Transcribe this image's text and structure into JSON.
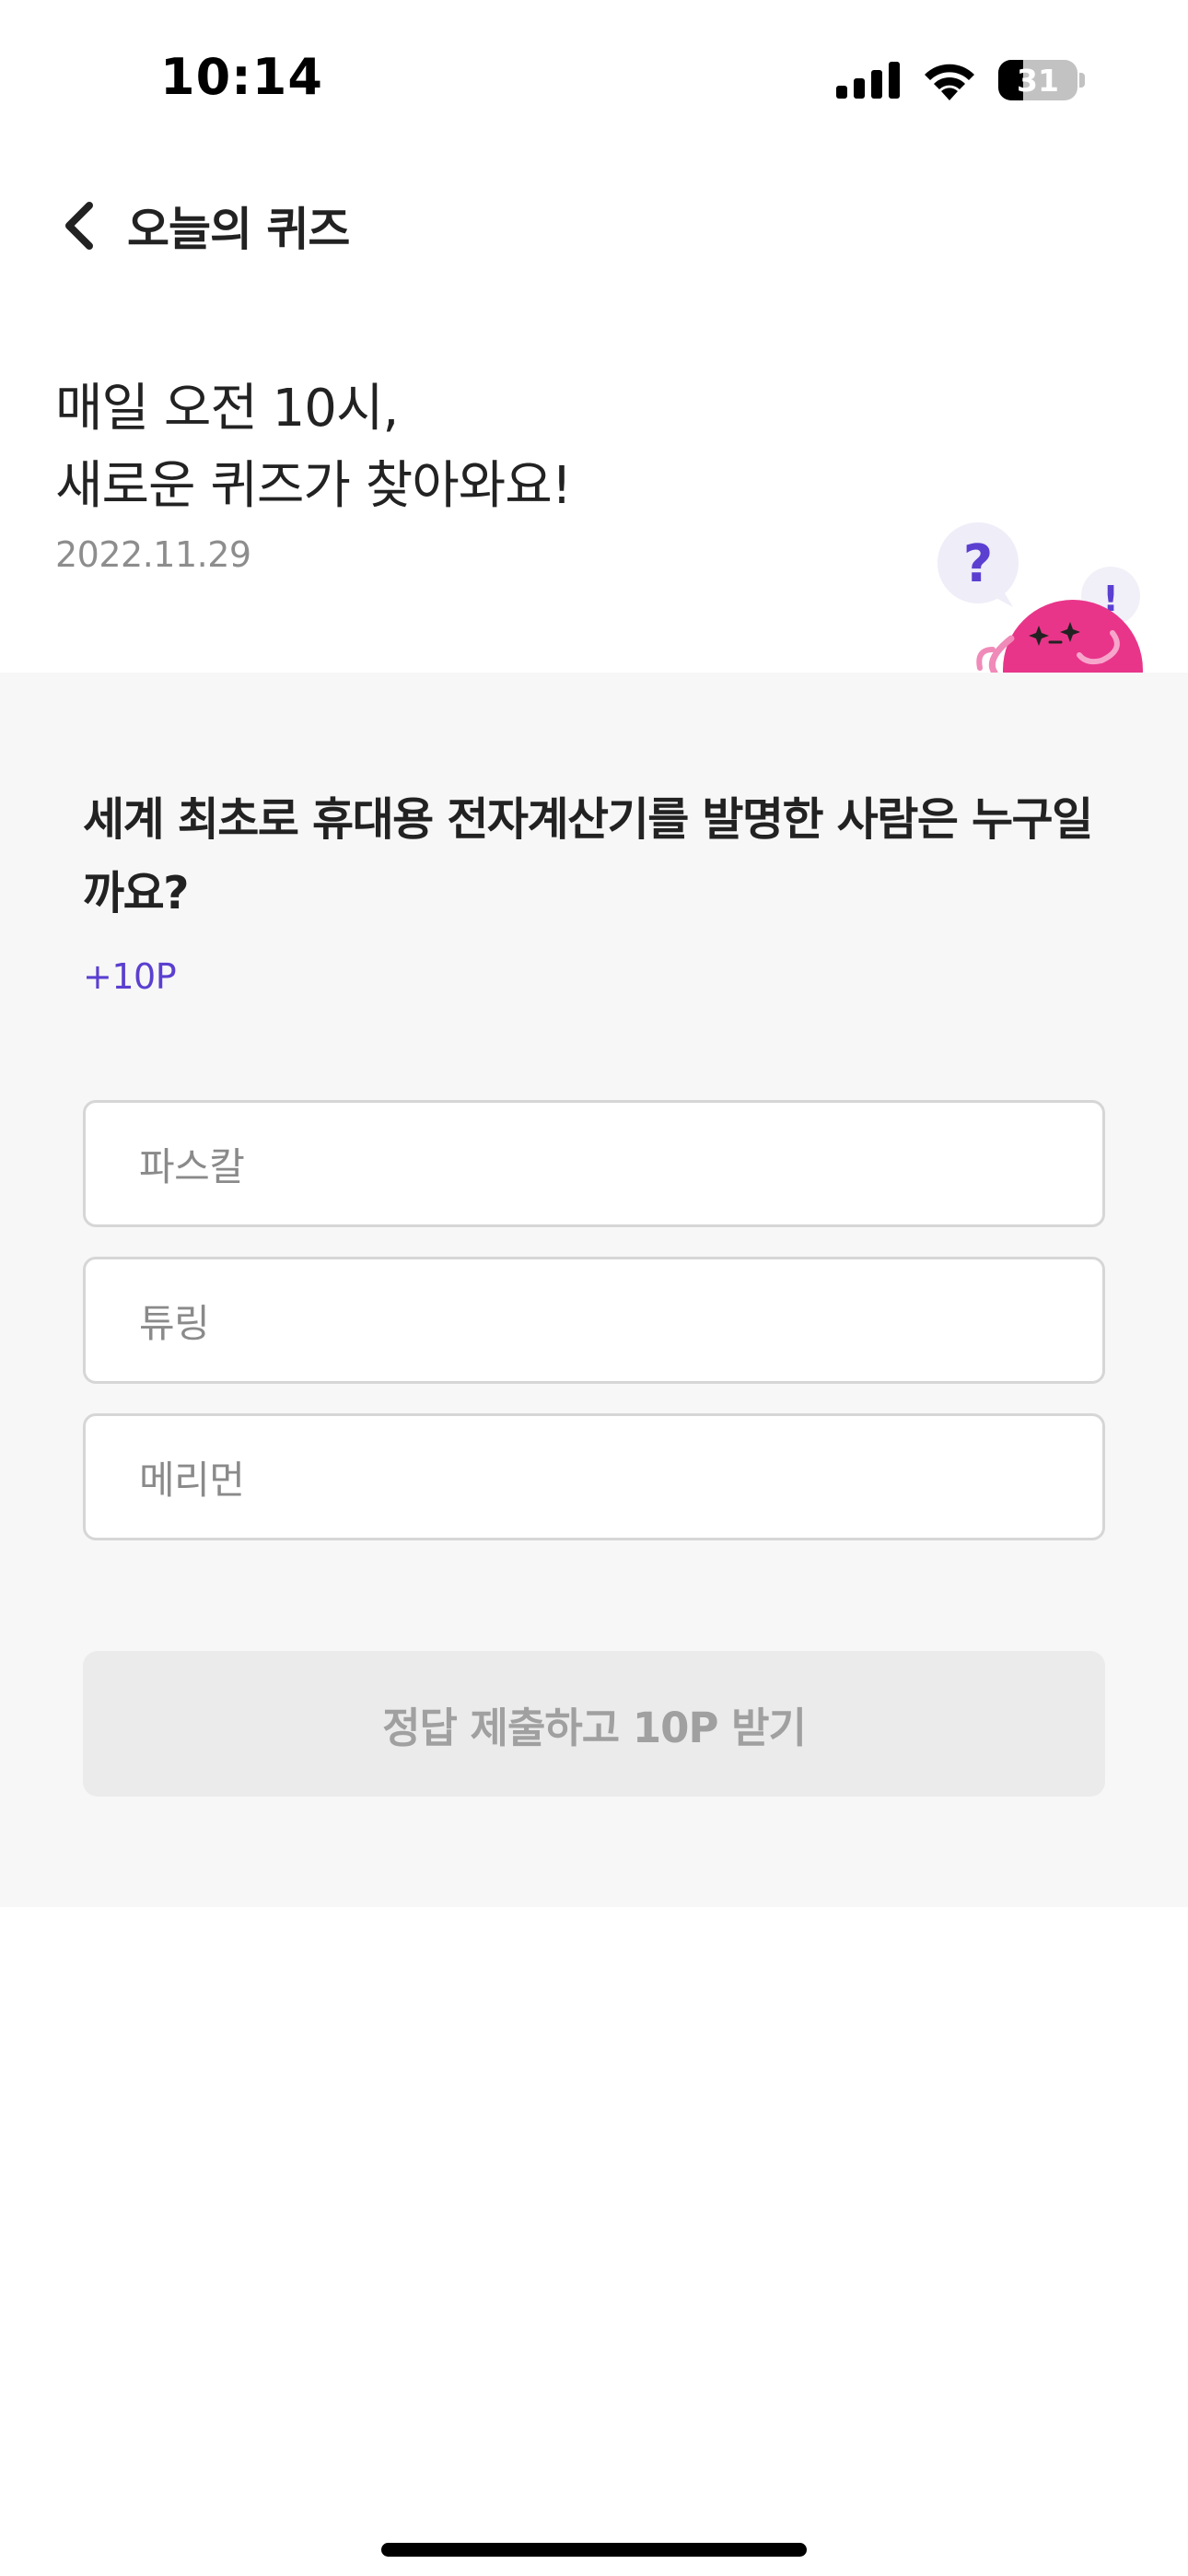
{
  "status_bar": {
    "time": "10:14",
    "battery_level": "31",
    "battery_fraction": 0.31,
    "icons": [
      "cellular-signal-icon",
      "wifi-icon",
      "battery-icon"
    ]
  },
  "nav": {
    "back_icon": "chevron-left-icon",
    "title": "오늘의 퀴즈"
  },
  "header": {
    "headline_line1": "매일 오전 10시,",
    "headline_line2": "새로운 퀴즈가 찾아와요!",
    "date": "2022.11.29",
    "mascot": {
      "icon": "quiz-mascot-illustration",
      "bubble_question": "?",
      "bubble_exclaim": "!"
    }
  },
  "quiz": {
    "question": "세계 최초로 휴대용 전자계산기를 발명한 사람은 누구일까요?",
    "reward": "+10P",
    "options": [
      {
        "label": "파스칼"
      },
      {
        "label": "튜링"
      },
      {
        "label": "메리먼"
      }
    ],
    "submit_label": "정답 제출하고 10P 받기"
  },
  "colors": {
    "accent_purple": "#5b3fd0",
    "mascot_pink": "#e8358a",
    "card_background": "#f7f7f7",
    "button_disabled_bg": "#ebebeb",
    "button_disabled_text": "#a0a0a0"
  }
}
